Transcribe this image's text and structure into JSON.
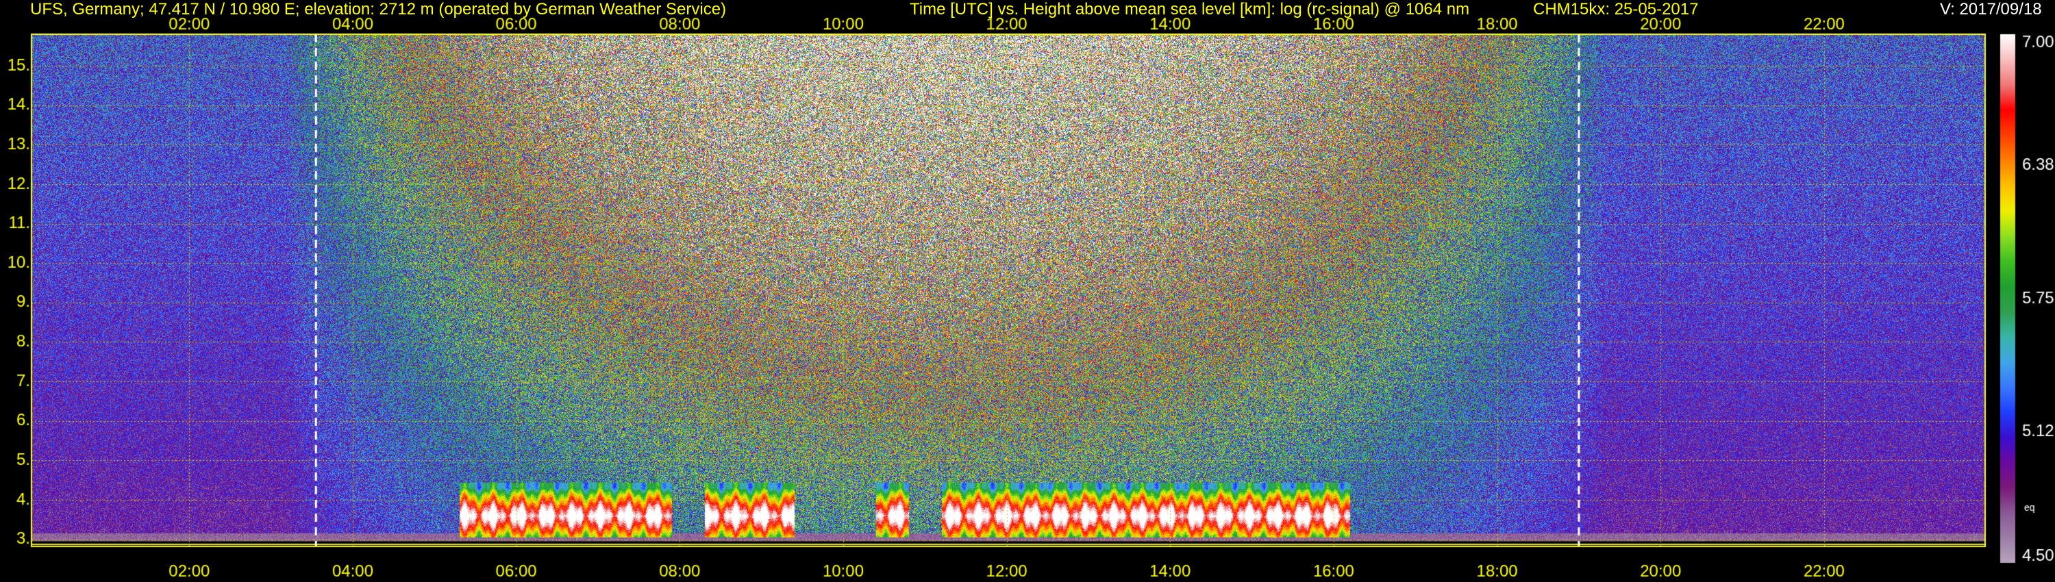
{
  "header": {
    "station": "UFS, Germany; 47.417 N / 10.980 E; elevation: 2712 m  (operated by German Weather Service)",
    "axes_title": "Time [UTC] vs. Height above mean sea level [km]: log (rc-signal) @ 1064 nm",
    "instrument": "CHM15kx: 25-05-2017",
    "version": "V: 2017/09/18"
  },
  "chart_data": {
    "type": "heatmap",
    "xlabel": "Time [UTC]",
    "ylabel": "Height above mean sea level [km]",
    "x_ticks": [
      "02:00",
      "04:00",
      "06:00",
      "08:00",
      "10:00",
      "12:00",
      "14:00",
      "16:00",
      "18:00",
      "20:00",
      "22:00"
    ],
    "x_tick_hours": [
      2,
      4,
      6,
      8,
      10,
      12,
      14,
      16,
      18,
      20,
      22
    ],
    "xlim_hours": [
      0.07,
      23.97
    ],
    "y_ticks": [
      "3.",
      "4.",
      "5.",
      "6.",
      "7.",
      "8.",
      "9.",
      "10.",
      "11.",
      "12.",
      "13.",
      "14.",
      "15."
    ],
    "y_tick_values": [
      3,
      4,
      5,
      6,
      7,
      8,
      9,
      10,
      11,
      12,
      13,
      14,
      15
    ],
    "ylim_km": [
      2.82,
      15.8
    ],
    "grid": true,
    "colorbar": {
      "ticks": [
        "7.00",
        "6.38",
        "5.75",
        "5.12",
        "4.50"
      ],
      "tick_values": [
        7.0,
        6.38,
        5.75,
        5.12,
        4.5
      ],
      "range": [
        4.5,
        7.0
      ],
      "footnote": "eq",
      "colors": [
        "#b9a5bf",
        "#9b7fa6",
        "#8a5a96",
        "#7a1a7a",
        "#6a0aa0",
        "#3a10d0",
        "#2040ff",
        "#3a78ff",
        "#40a6e6",
        "#38b6a8",
        "#30a050",
        "#20a030",
        "#40c020",
        "#90e020",
        "#f0f000",
        "#ffc000",
        "#ff8000",
        "#ff4000",
        "#ff0000",
        "#f07878",
        "#f8c0c0",
        "#ffffff"
      ]
    },
    "markers": {
      "sunrise_hour": 3.55,
      "sunset_hour": 19.0
    },
    "aerosol_layer": {
      "start_hour": 5.3,
      "end_hour": 16.2,
      "base_km": 3.05,
      "top_km": 4.45,
      "gaps_hours": [
        [
          7.9,
          8.3
        ],
        [
          9.4,
          10.4
        ],
        [
          10.8,
          11.2
        ]
      ]
    }
  }
}
